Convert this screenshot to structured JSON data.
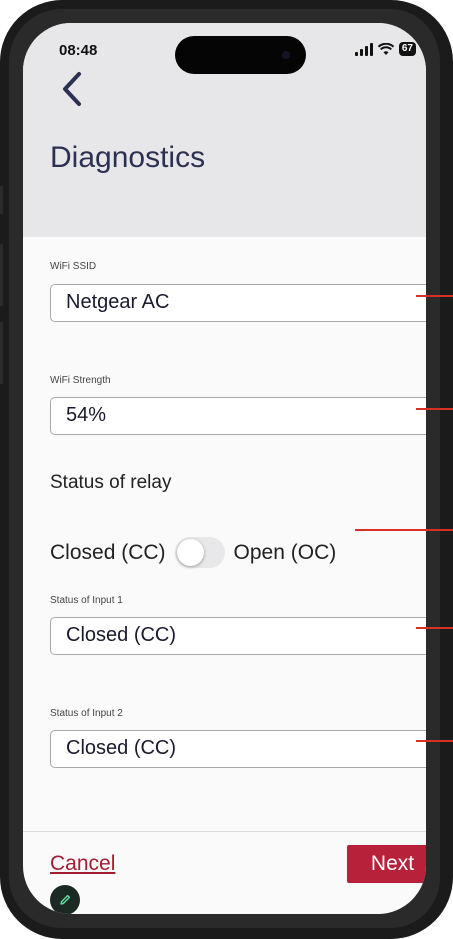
{
  "status_bar": {
    "time": "08:48",
    "battery": "67",
    "icons": [
      "signal-icon",
      "wifi-icon",
      "battery-icon"
    ]
  },
  "header": {
    "back_icon": "chevron-left-icon",
    "title": "Diagnostics"
  },
  "form": {
    "wifi_ssid": {
      "label": "WiFi SSID",
      "value": "Netgear AC"
    },
    "wifi_strength": {
      "label": "WiFi Strength",
      "value": "54%"
    },
    "relay": {
      "label": "Status of relay",
      "left_option": "Closed (CC)",
      "right_option": "Open (OC)",
      "toggle_on": false
    },
    "input1": {
      "label": "Status of Input 1",
      "value": "Closed (CC)"
    },
    "input2": {
      "label": "Status of Input 2",
      "value": "Closed (CC)"
    }
  },
  "footer": {
    "cancel_label": "Cancel",
    "next_label": "Next",
    "edit_icon": "pencil-icon"
  },
  "colors": {
    "title": "#2c3152",
    "accent": "#b8213a",
    "link": "#a31d31",
    "header_bg": "#e7e6e9",
    "callout": "#d93025"
  }
}
